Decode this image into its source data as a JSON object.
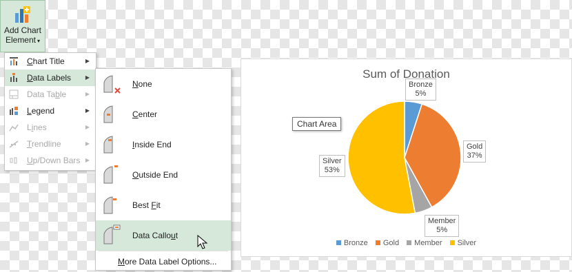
{
  "ribbon": {
    "button_label_line1": "Add Chart",
    "button_label_line2": "Element",
    "button_icon": "add-chart-element-icon"
  },
  "menu": {
    "items": [
      {
        "label_pre": "",
        "label_u": "C",
        "label_post": "hart Title",
        "icon": "chart-title-icon",
        "state": "normal"
      },
      {
        "label_pre": "",
        "label_u": "D",
        "label_post": "ata Labels",
        "icon": "data-labels-icon",
        "state": "active"
      },
      {
        "label_pre": "Data Ta",
        "label_u": "b",
        "label_post": "le",
        "icon": "data-table-icon",
        "state": "disabled"
      },
      {
        "label_pre": "",
        "label_u": "L",
        "label_post": "egend",
        "icon": "legend-icon",
        "state": "normal"
      },
      {
        "label_pre": "L",
        "label_u": "i",
        "label_post": "nes",
        "icon": "lines-icon",
        "state": "disabled"
      },
      {
        "label_pre": "",
        "label_u": "T",
        "label_post": "rendline",
        "icon": "trendline-icon",
        "state": "disabled"
      },
      {
        "label_pre": "",
        "label_u": "U",
        "label_post": "p/Down Bars",
        "icon": "up-down-bars-icon",
        "state": "disabled"
      }
    ]
  },
  "submenu": {
    "items": [
      {
        "label_pre": "",
        "label_u": "N",
        "label_post": "one",
        "icon": "label-none-icon"
      },
      {
        "label_pre": "",
        "label_u": "C",
        "label_post": "enter",
        "icon": "label-center-icon"
      },
      {
        "label_pre": "",
        "label_u": "I",
        "label_post": "nside End",
        "icon": "label-inside-end-icon"
      },
      {
        "label_pre": "",
        "label_u": "O",
        "label_post": "utside End",
        "icon": "label-outside-end-icon"
      },
      {
        "label_pre": "Best ",
        "label_u": "F",
        "label_post": "it",
        "icon": "label-best-fit-icon"
      },
      {
        "label_pre": "Data Callo",
        "label_u": "u",
        "label_post": "t",
        "icon": "label-data-callout-icon"
      }
    ],
    "hover_index": 5,
    "more_pre": "",
    "more_u": "M",
    "more_post": "ore Data Label Options..."
  },
  "tooltip": "Chart Area",
  "chart_data": {
    "type": "pie",
    "title": "Sum of Donation",
    "slices": [
      {
        "name": "Bronze",
        "percent": 5,
        "label": "5%",
        "color": "#5b9bd5"
      },
      {
        "name": "Gold",
        "percent": 37,
        "label": "37%",
        "color": "#ed7d31"
      },
      {
        "name": "Member",
        "percent": 5,
        "label": "5%",
        "color": "#a5a5a5"
      },
      {
        "name": "Silver",
        "percent": 53,
        "label": "53%",
        "color": "#ffc000"
      }
    ],
    "legend": [
      "Bronze",
      "Gold",
      "Member",
      "Silver"
    ],
    "legend_placement": "bottom"
  },
  "colors": {
    "accent": "#d5e8d9"
  }
}
